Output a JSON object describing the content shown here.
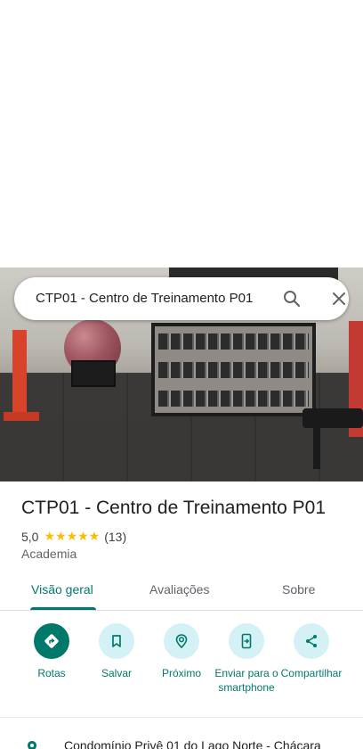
{
  "search": {
    "query": "CTP01 - Centro de Treinamento P01"
  },
  "place": {
    "name": "CTP01 - Centro de Treinamento P01",
    "rating": "5,0",
    "stars": "★★★★★",
    "reviews_count": "(13)",
    "category": "Academia"
  },
  "tabs": [
    {
      "label": "Visão geral",
      "active": true
    },
    {
      "label": "Avaliações",
      "active": false
    },
    {
      "label": "Sobre",
      "active": false
    }
  ],
  "actions": [
    {
      "label": "Rotas",
      "icon": "directions-icon"
    },
    {
      "label": "Salvar",
      "icon": "bookmark-icon"
    },
    {
      "label": "Próximo",
      "icon": "nearby-icon"
    },
    {
      "label": "Enviar para o smartphone",
      "icon": "send-to-phone-icon"
    },
    {
      "label": "Compartilhar",
      "icon": "share-icon"
    }
  ],
  "address": {
    "text": "Condomínio Privê 01 do Lago Norte - Chácara"
  },
  "colors": {
    "accent": "#00796b",
    "action_bg": "#d4f1f5",
    "star": "#fbbc04"
  }
}
